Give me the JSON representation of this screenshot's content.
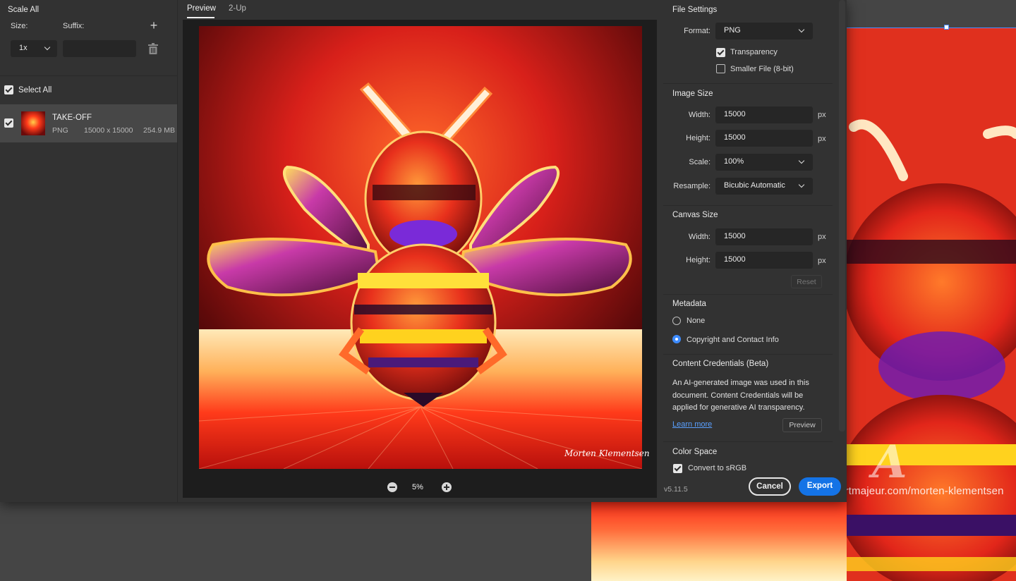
{
  "left": {
    "scale_header": "Scale All",
    "size_label": "Size:",
    "suffix_label": "Suffix:",
    "scale_value": "1x",
    "suffix_value": "",
    "select_all": "Select All",
    "asset": {
      "name": "TAKE-OFF",
      "format": "PNG",
      "dimensions": "15000 x 15000",
      "size": "254.9 MB"
    }
  },
  "center": {
    "tabs": [
      "Preview",
      "2-Up"
    ],
    "zoom": "5%",
    "signature": "Morten Klementsen"
  },
  "right": {
    "file_settings": {
      "title": "File Settings",
      "format_label": "Format:",
      "format_value": "PNG",
      "transparency": "Transparency",
      "smaller_file": "Smaller File (8-bit)"
    },
    "image_size": {
      "title": "Image Size",
      "width_label": "Width:",
      "width": "15000",
      "height_label": "Height:",
      "height": "15000",
      "scale_label": "Scale:",
      "scale": "100%",
      "resample_label": "Resample:",
      "resample": "Bicubic Automatic",
      "unit": "px"
    },
    "canvas_size": {
      "title": "Canvas Size",
      "width_label": "Width:",
      "width": "15000",
      "height_label": "Height:",
      "height": "15000",
      "unit": "px",
      "reset": "Reset"
    },
    "metadata": {
      "title": "Metadata",
      "none": "None",
      "copyright": "Copyright and Contact Info"
    },
    "content_credentials": {
      "title": "Content Credentials (Beta)",
      "text": "An AI-generated image was used in this document. Content Credentials will be applied for generative AI transparency.",
      "learn_more": "Learn more",
      "preview": "Preview"
    },
    "color_space": {
      "title": "Color Space",
      "convert": "Convert to sRGB"
    }
  },
  "footer": {
    "version": "v5.11.5",
    "cancel": "Cancel",
    "export": "Export"
  },
  "watermark": "©Artmajeur.com/morten-klementsen",
  "colors": {
    "accent": "#1473e6",
    "panel": "#323232",
    "field": "#262626"
  }
}
